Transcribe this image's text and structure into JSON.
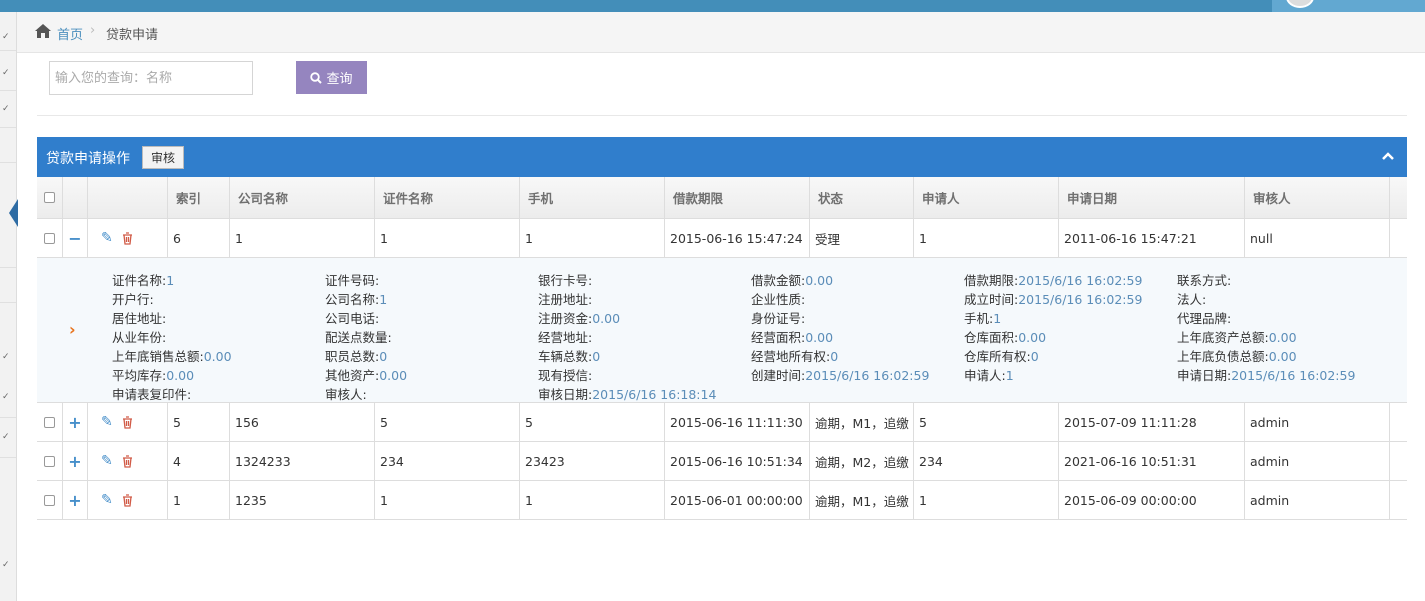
{
  "breadcrumb": {
    "home": "首页",
    "sep": "›",
    "current": "贷款申请"
  },
  "search": {
    "placeholder": "输入您的查询：名称",
    "value": "",
    "button": "查询"
  },
  "panel": {
    "title": "贷款申请操作",
    "audit_button": "审核"
  },
  "table": {
    "headers": [
      "索引",
      "公司名称",
      "证件名称",
      "手机",
      "借款期限",
      "状态",
      "申请人",
      "申请日期",
      "审核人"
    ],
    "rows": [
      {
        "expander": "−",
        "cells": [
          "6",
          "1",
          "1",
          "1",
          "2015-06-16 15:47:24",
          "受理",
          "1",
          "2011-06-16 15:47:21",
          "null"
        ]
      },
      {
        "expander": "+",
        "cells": [
          "5",
          "156",
          "5",
          "5",
          "2015-06-16 11:11:30",
          "逾期，M1，追缴",
          "5",
          "2015-07-09 11:11:28",
          "admin"
        ]
      },
      {
        "expander": "+",
        "cells": [
          "4",
          "1324233",
          "234",
          "23423",
          "2015-06-16 10:51:34",
          "逾期，M2，追缴",
          "234",
          "2021-06-16 10:51:31",
          "admin"
        ]
      },
      {
        "expander": "+",
        "cells": [
          "1",
          "1235",
          "1",
          "1",
          "2015-06-01 00:00:00",
          "逾期，M1，追缴",
          "1",
          "2015-06-09 00:00:00",
          "admin"
        ]
      }
    ]
  },
  "detail": {
    "arrow": "›",
    "fields": [
      [
        {
          "k": "证件名称:",
          "v": "1"
        },
        {
          "k": "证件号码:",
          "v": ""
        },
        {
          "k": "银行卡号:",
          "v": ""
        },
        {
          "k": "借款金额:",
          "v": "0.00"
        },
        {
          "k": "借款期限:",
          "v": "2015/6/16 16:02:59"
        },
        {
          "k": "联系方式:",
          "v": ""
        }
      ],
      [
        {
          "k": "开户行:",
          "v": ""
        },
        {
          "k": "公司名称:",
          "v": "1"
        },
        {
          "k": "注册地址:",
          "v": ""
        },
        {
          "k": "企业性质:",
          "v": ""
        },
        {
          "k": "成立时间:",
          "v": "2015/6/16 16:02:59"
        },
        {
          "k": "法人:",
          "v": ""
        }
      ],
      [
        {
          "k": "居住地址:",
          "v": ""
        },
        {
          "k": "公司电话:",
          "v": ""
        },
        {
          "k": "注册资金:",
          "v": "0.00"
        },
        {
          "k": "身份证号:",
          "v": ""
        },
        {
          "k": "手机:",
          "v": "1"
        },
        {
          "k": "代理品牌:",
          "v": ""
        }
      ],
      [
        {
          "k": "从业年份:",
          "v": ""
        },
        {
          "k": "配送点数量:",
          "v": ""
        },
        {
          "k": "经营地址:",
          "v": ""
        },
        {
          "k": "经营面积:",
          "v": "0.00"
        },
        {
          "k": "仓库面积:",
          "v": "0.00"
        },
        {
          "k": "上年底资产总额:",
          "v": "0.00"
        }
      ],
      [
        {
          "k": "上年底销售总额:",
          "v": "0.00"
        },
        {
          "k": "职员总数:",
          "v": "0"
        },
        {
          "k": "车辆总数:",
          "v": "0"
        },
        {
          "k": "经营地所有权:",
          "v": "0"
        },
        {
          "k": "仓库所有权:",
          "v": "0"
        },
        {
          "k": "上年底负债总额:",
          "v": "0.00"
        }
      ],
      [
        {
          "k": "平均库存:",
          "v": "0.00"
        },
        {
          "k": "其他资产:",
          "v": "0.00"
        },
        {
          "k": "现有授信:",
          "v": ""
        },
        {
          "k": "创建时间:",
          "v": "2015/6/16 16:02:59"
        },
        {
          "k": "申请人:",
          "v": "1"
        },
        {
          "k": "申请日期:",
          "v": "2015/6/16 16:02:59"
        }
      ],
      [
        {
          "k": "申请表复印件:",
          "v": ""
        },
        {
          "k": "审核人:",
          "v": ""
        },
        {
          "k": "审核日期:",
          "v": "2015/6/16 16:18:14"
        }
      ]
    ]
  },
  "colors": {
    "topbar": "#438eb9",
    "panel": "#307ecc",
    "search_button": "#9585bf",
    "link": "#4c8fbd",
    "delete": "#d15b47"
  }
}
